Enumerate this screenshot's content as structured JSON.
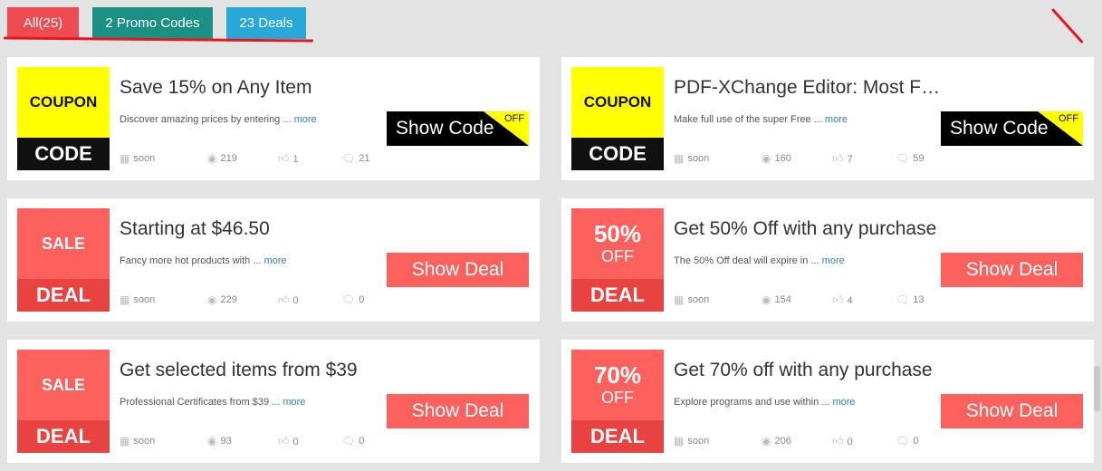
{
  "filters": {
    "all": "All(25)",
    "promo": "2 Promo Codes",
    "deals": "23 Deals"
  },
  "cards": [
    {
      "type": "coupon",
      "badge_top": "COUPON",
      "badge_bottom": "CODE",
      "title": "Save 15% on Any Item",
      "desc": "Discover amazing prices by entering ...",
      "more": "more",
      "date": "soon",
      "views": "219",
      "likes": "1",
      "comments": "21",
      "action": "Show Code",
      "action_tag": "OFF"
    },
    {
      "type": "coupon",
      "badge_top": "COUPON",
      "badge_bottom": "CODE",
      "title": "PDF-XChange Editor: Most Feature-rich FREE ...",
      "desc": "Make full use of the super Free ...",
      "more": "more",
      "date": "soon",
      "views": "160",
      "likes": "7",
      "comments": "59",
      "action": "Show Code",
      "action_tag": "OFF"
    },
    {
      "type": "deal",
      "badge_top": "SALE",
      "badge_bottom": "DEAL",
      "title": "Starting at $46.50",
      "desc": "Fancy more hot products with ...",
      "more": "more",
      "date": "soon",
      "views": "229",
      "likes": "0",
      "comments": "0",
      "action": "Show Deal"
    },
    {
      "type": "deal",
      "badge_pct": "50%",
      "badge_off": "OFF",
      "badge_bottom": "DEAL",
      "title": "Get 50% Off with any purchase",
      "desc": "The 50% Off deal will expire in ...",
      "more": "more",
      "date": "soon",
      "views": "154",
      "likes": "4",
      "comments": "13",
      "action": "Show Deal"
    },
    {
      "type": "deal",
      "badge_top": "SALE",
      "badge_bottom": "DEAL",
      "title": "Get selected items from $39",
      "desc": "Professional Certificates from $39 ...",
      "more": "more",
      "date": "soon",
      "views": "93",
      "likes": "0",
      "comments": "0",
      "action": "Show Deal"
    },
    {
      "type": "deal",
      "badge_pct": "70%",
      "badge_off": "OFF",
      "badge_bottom": "DEAL",
      "title": "Get 70% off with any purchase",
      "desc": "Explore programs and use within ...",
      "more": "more",
      "date": "soon",
      "views": "206",
      "likes": "0",
      "comments": "0",
      "action": "Show Deal"
    }
  ],
  "icons": {
    "date": "calendar-icon",
    "views": "eye-icon",
    "likes": "thumbs-up-icon",
    "comments": "comment-icon"
  },
  "colors": {
    "all": "#ee4b52",
    "promo": "#1b9185",
    "deals": "#28a7d9",
    "coupon_yellow": "#ffff00",
    "deal_red": "#fd615e",
    "annotation_red": "#e8151b"
  }
}
